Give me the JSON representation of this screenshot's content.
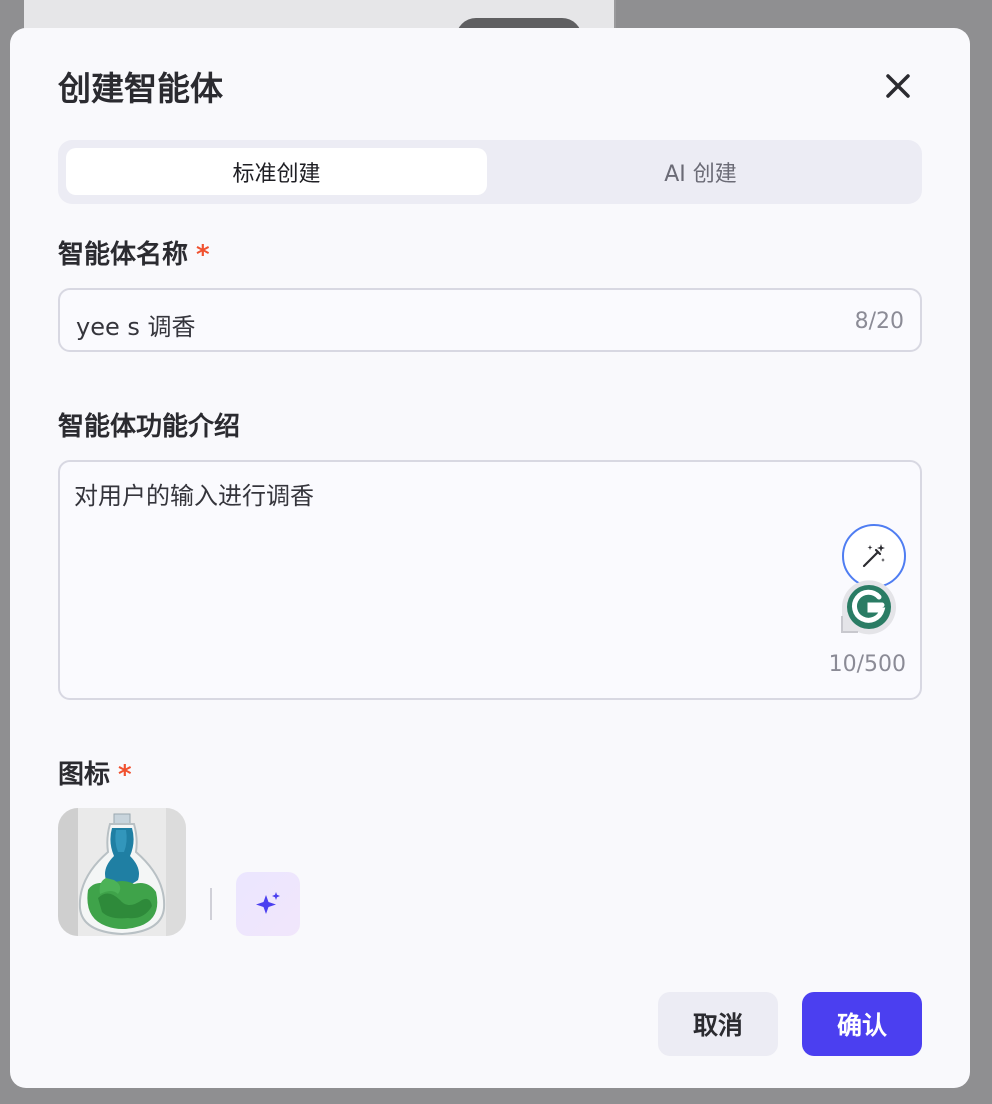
{
  "dialog": {
    "title": "创建智能体",
    "close_icon": "close-icon"
  },
  "tabs": [
    {
      "label": "标准创建",
      "active": true
    },
    {
      "label": "AI 创建",
      "active": false
    }
  ],
  "name_field": {
    "label": "智能体名称",
    "required_mark": "*",
    "value": "yee s 调香",
    "counter": "8/20"
  },
  "description_field": {
    "label": "智能体功能介绍",
    "value": "对用户的输入进行调香",
    "counter": "10/500",
    "magic_icon": "wand-sparkle-icon",
    "assistant_icon": "grammarly-icon"
  },
  "icon_field": {
    "label": "图标",
    "required_mark": "*",
    "preview_icon": "perfume-bottle-image",
    "generate_icon": "sparkle-icon"
  },
  "actions": {
    "cancel_label": "取消",
    "confirm_label": "确认"
  },
  "colors": {
    "accent": "#4b3ff0",
    "required": "#f0512f",
    "focus_ring": "#4f7df2"
  }
}
